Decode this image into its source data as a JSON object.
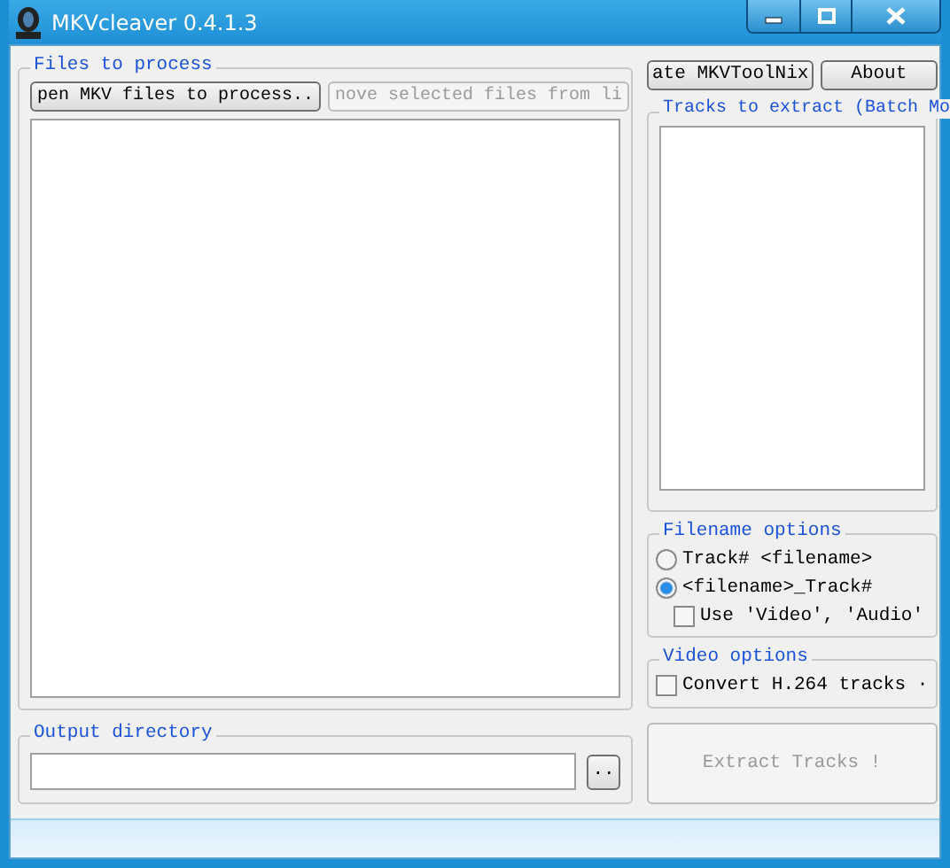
{
  "window": {
    "title": "MKVcleaver 0.4.1.3"
  },
  "files_group": {
    "legend": "Files to process",
    "buttons": [
      {
        "label": "pen MKV files to process..",
        "disabled": false
      },
      {
        "label": "nove selected files from li",
        "disabled": true
      }
    ]
  },
  "top_buttons": [
    {
      "label": "ate MKVToolNix",
      "disabled": false
    },
    {
      "label": "About",
      "disabled": false
    }
  ],
  "tracks_group": {
    "legend": "Tracks to extract (Batch Mo"
  },
  "filename_options": {
    "legend": "Filename options",
    "options": [
      {
        "kind": "radio",
        "label": "Track# <filename>",
        "selected": false
      },
      {
        "kind": "radio",
        "label": "<filename>_Track#",
        "selected": true
      },
      {
        "kind": "checkbox",
        "label": "Use 'Video', 'Audio'",
        "checked": false
      }
    ]
  },
  "video_options": {
    "legend": "Video options",
    "options": [
      {
        "kind": "checkbox",
        "label": "Convert H.264 tracks ·",
        "checked": false
      }
    ]
  },
  "output_group": {
    "legend": "Output directory",
    "browse_button": ".."
  },
  "extract_button": {
    "label": "Extract Tracks !",
    "disabled": true
  }
}
